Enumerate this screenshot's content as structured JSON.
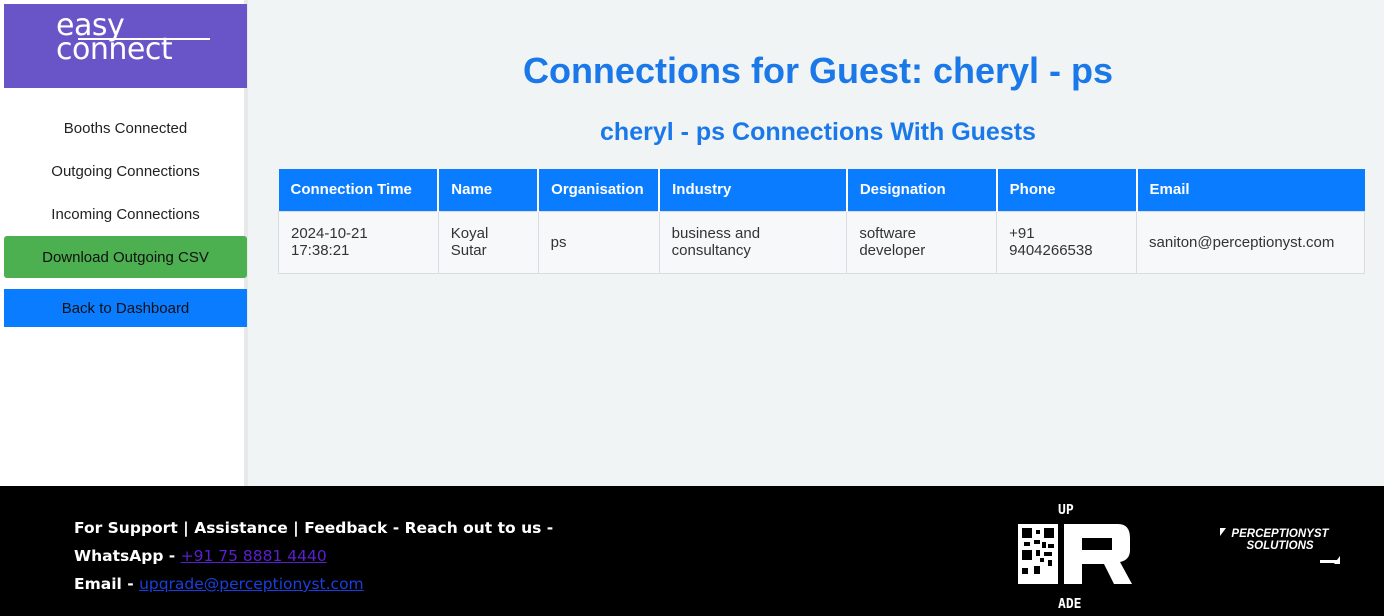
{
  "sidebar": {
    "logo": {
      "line1": "easy",
      "line2": "connect"
    },
    "items": [
      {
        "label": "Booths Connected"
      },
      {
        "label": "Outgoing Connections"
      },
      {
        "label": "Incoming Connections"
      }
    ],
    "download_label": "Download Outgoing CSV",
    "back_label": "Back to Dashboard"
  },
  "main": {
    "title": "Connections for Guest: cheryl - ps",
    "subtitle": "cheryl - ps Connections With Guests",
    "table": {
      "headers": [
        "Connection Time",
        "Name",
        "Organisation",
        "Industry",
        "Designation",
        "Phone",
        "Email"
      ],
      "rows": [
        {
          "time_date": "2024-10-21",
          "time_clock": "17:38:21",
          "name_first": "Koyal",
          "name_last": "Sutar",
          "organisation": "ps",
          "industry_1": "business and",
          "industry_2": "consultancy",
          "designation_1": "software",
          "designation_2": "developer",
          "phone_1": "+91",
          "phone_2": "9404266538",
          "email": "saniton@perceptionyst.com"
        }
      ]
    }
  },
  "footer": {
    "line1": "For Support | Assistance | Feedback - Reach out to us -",
    "whatsapp_label": "WhatsApp - ",
    "whatsapp_value": "+91 75 8881 4440",
    "email_label": "Email - ",
    "email_value": "upqrade@perceptionyst.com",
    "qr_logo": {
      "top": "UP",
      "bottom": "ADE"
    },
    "company_logo": {
      "line1": "PERCEPTIONYST",
      "line2": "SOLUTIONS"
    }
  },
  "colors": {
    "accent_blue": "#0a7cff",
    "title_blue": "#1a78e8",
    "logo_purple": "#6a55c8",
    "download_green": "#4caf50"
  }
}
